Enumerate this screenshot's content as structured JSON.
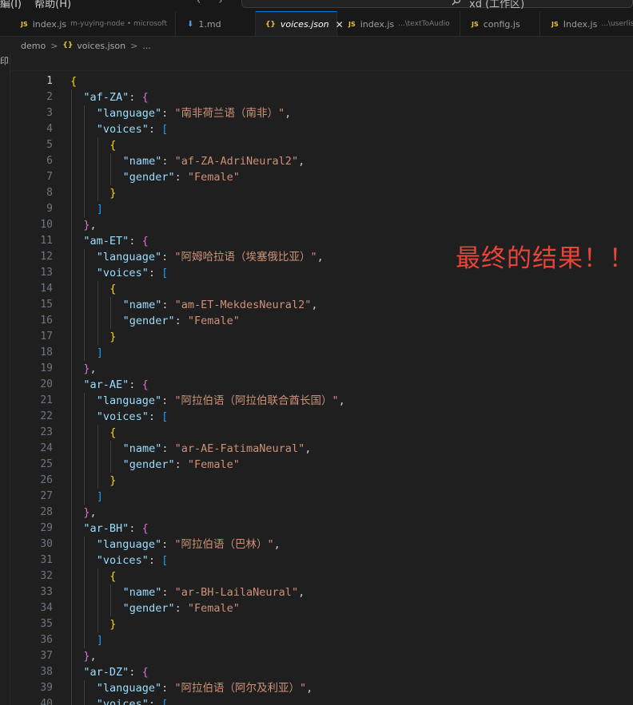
{
  "menu": {
    "items": [
      "編(I)",
      "帮助(H)"
    ]
  },
  "nav": {
    "back": "‹",
    "forward": "›"
  },
  "command_center": {
    "text": "xd (工作区)"
  },
  "tabs": [
    {
      "icon": "js-file-icon",
      "label": "index.js",
      "desc": "m-yuying-node • microsoft",
      "active": false
    },
    {
      "icon": "markdown-file-icon",
      "label": "1.md",
      "desc": "",
      "active": false
    },
    {
      "icon": "json-file-icon",
      "label": "voices.json",
      "desc": "",
      "active": true
    },
    {
      "icon": "js-file-icon",
      "label": "index.js",
      "desc": "...\\textToAudio",
      "active": false
    },
    {
      "icon": "js-file-icon",
      "label": "config.js",
      "desc": "",
      "active": false
    },
    {
      "icon": "js-file-icon",
      "label": "Index.js",
      "desc": "...\\userlist",
      "active": false
    }
  ],
  "tab_glyphs": {
    "js": "JS",
    "md": "⬇",
    "json": "{}",
    "close": "✕"
  },
  "breadcrumb": {
    "folder": "demo",
    "file": "voices.json",
    "symbol": "...",
    "sep": ">"
  },
  "sidebar_glyph": "印",
  "editor": {
    "current_line": 1,
    "entries": [
      {
        "code": "af-ZA",
        "language": "南非荷兰语（南非）",
        "voice": "af-ZA-AdriNeural2",
        "gender": "Female"
      },
      {
        "code": "am-ET",
        "language": "阿姆哈拉语（埃塞俄比亚）",
        "voice": "am-ET-MekdesNeural2",
        "gender": "Female"
      },
      {
        "code": "ar-AE",
        "language": "阿拉伯语（阿拉伯联合酋长国）",
        "voice": "ar-AE-FatimaNeural",
        "gender": "Female"
      },
      {
        "code": "ar-BH",
        "language": "阿拉伯语（巴林）",
        "voice": "ar-BH-LailaNeural",
        "gender": "Female"
      },
      {
        "code": "ar-DZ",
        "language": "阿拉伯语（阿尔及利亚）",
        "voice": "",
        "gender": ""
      }
    ]
  },
  "annotation": "最终的结果！！",
  "colors": {
    "accent": "#0078d4",
    "annotation": "#e8443a",
    "key": "#9cdcfe",
    "string": "#ce9178"
  }
}
